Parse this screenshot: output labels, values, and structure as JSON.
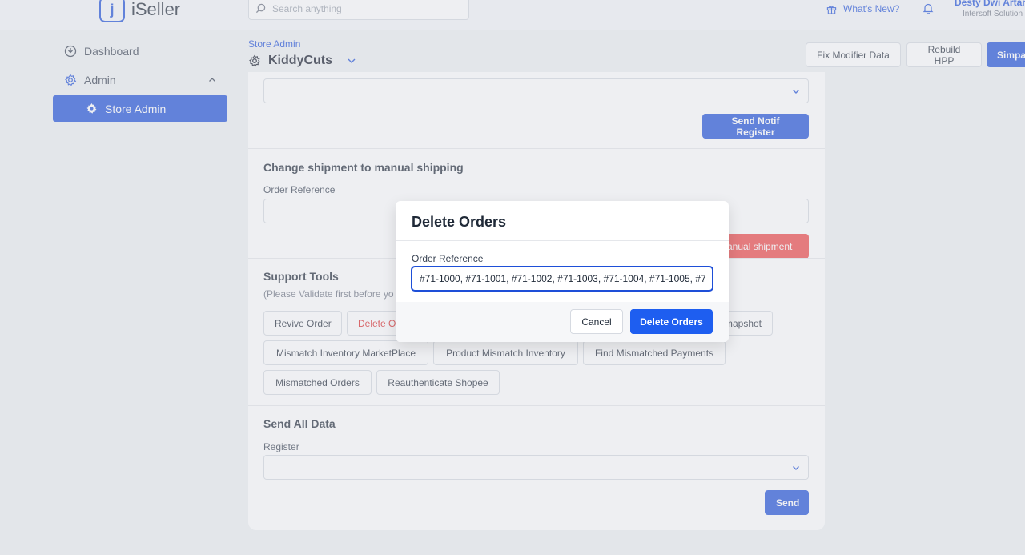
{
  "brand": {
    "name": "iSeller",
    "logo_mark": "j"
  },
  "topbar": {
    "search_placeholder": "Search anything",
    "whats_new": "What's New?",
    "user_name": "Desty Dwi Artan",
    "user_org": "Intersoft Solution"
  },
  "sidebar": {
    "items": [
      {
        "label": "Dashboard",
        "icon": "dashboard-icon"
      },
      {
        "label": "Admin",
        "icon": "gear-icon"
      },
      {
        "label": "Store Admin",
        "icon": "gear-icon",
        "active": true
      }
    ]
  },
  "header": {
    "breadcrumb": "Store Admin",
    "store_name": "KiddyCuts",
    "buttons": {
      "fix_modifier": "Fix Modifier Data",
      "rebuild_hpp": "Rebuild HPP",
      "simpan": "Simpa"
    }
  },
  "sections": {
    "notif": {
      "button": "Send Notif Register"
    },
    "shipment": {
      "title": "Change shipment to manual shipping",
      "label": "Order Reference",
      "button": "anual shipment"
    },
    "support": {
      "title": "Support Tools",
      "note": "(Please Validate first before yo",
      "tools": [
        "Revive Order",
        "Delete O",
        "napshot",
        "Mismatch Inventory MarketPlace",
        "Product Mismatch Inventory",
        "Find Mismatched Payments",
        "Mismatched Orders",
        "Reauthenticate Shopee"
      ]
    },
    "send_all": {
      "title": "Send All Data",
      "label": "Register",
      "button": "Send"
    }
  },
  "modal": {
    "title": "Delete Orders",
    "label": "Order Reference",
    "value": "#71-1000, #71-1001, #71-1002, #71-1003, #71-1004, #71-1005, #71",
    "cancel": "Cancel",
    "confirm": "Delete Orders"
  },
  "colors": {
    "primary": "#1e4fd8",
    "danger": "#ef4444"
  }
}
